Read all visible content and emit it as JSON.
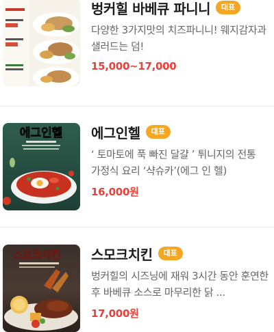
{
  "menu": {
    "items": [
      {
        "name": "벙커힐 바베큐 파니니",
        "badge": "대표",
        "description": "다양한 3가지맛의 치즈파니니! 웨지감자과 샐러드는 덤!",
        "price": "15,000~17,000"
      },
      {
        "name": "에그인헬",
        "badge": "대표",
        "description": "‘ 토마토에 푹 빠진 달걀 ’ 튀니지의 전통 가정식 요리 ‘샥슈카’(에그 인 헬)",
        "price": "16,000원",
        "image_caption": "에그인헬"
      },
      {
        "name": "스모크치킨",
        "badge": "대표",
        "description": "벙커힐의 시즈닝에 재워 3시간 동안 훈연한 후 바베큐 소스로 마무리한 닭 ...",
        "price": "17,000원",
        "image_caption": "스모크치킨"
      }
    ]
  },
  "colors": {
    "price": "#e8413b",
    "badge": "#f5a623"
  }
}
